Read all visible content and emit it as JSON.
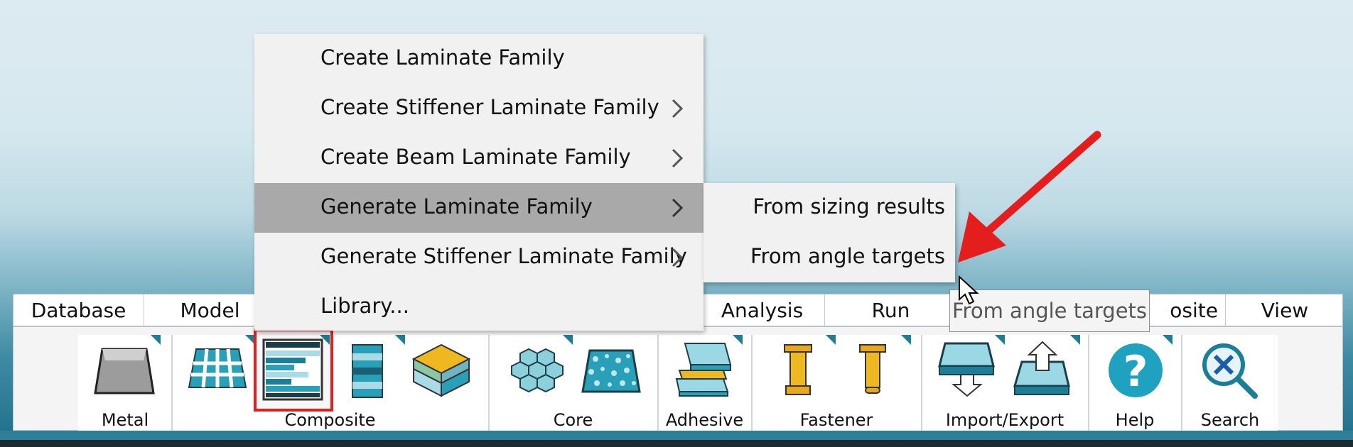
{
  "tabs": [
    "Database",
    "Model",
    "Analysis",
    "Run",
    "osite",
    "View"
  ],
  "context_menu": {
    "items": [
      {
        "label": "Create Laminate Family",
        "has_submenu": false
      },
      {
        "label": "Create Stiffener Laminate Family",
        "has_submenu": true
      },
      {
        "label": "Create Beam Laminate Family",
        "has_submenu": true
      },
      {
        "label": "Generate Laminate Family",
        "has_submenu": true,
        "active": true
      },
      {
        "label": "Generate Stiffener Laminate Family",
        "has_submenu": true
      },
      {
        "label": "Library...",
        "has_submenu": false
      }
    ],
    "submenu": [
      "From sizing results",
      "From angle targets"
    ]
  },
  "tooltip": "From angle targets",
  "ribbon_groups": [
    "Metal",
    "Composite",
    "Core",
    "Adhesive",
    "Fastener",
    "Import/Export",
    "Help",
    "Search"
  ],
  "colors": {
    "accent": "#207d93",
    "arrow": "#e41d1d",
    "menu_bg": "#f1f1f1",
    "menu_active": "#a9a9a9"
  }
}
